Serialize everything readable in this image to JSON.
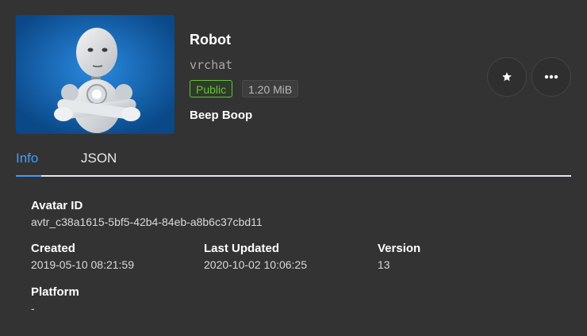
{
  "avatar": {
    "name": "Robot",
    "author": "vrchat",
    "release_status": "Public",
    "file_size": "1.20 MiB",
    "description": "Beep Boop",
    "thumbnail_alt": "robot-thumbnail"
  },
  "actions": {
    "favorite_icon": "star-icon",
    "more_icon": "more-horizontal-icon"
  },
  "tabs": [
    {
      "label": "Info",
      "active": true
    },
    {
      "label": "JSON",
      "active": false
    }
  ],
  "info": {
    "avatar_id_label": "Avatar ID",
    "avatar_id": "avtr_c38a1615-5bf5-42b4-84eb-a8b6c37cbd11",
    "created_label": "Created",
    "created": "2019-05-10 08:21:59",
    "updated_label": "Last Updated",
    "updated": "2020-10-02 10:06:25",
    "version_label": "Version",
    "version": "13",
    "platform_label": "Platform",
    "platform": "-"
  },
  "colors": {
    "background": "#333333",
    "accent": "#409eff",
    "public": "#67c23a"
  }
}
